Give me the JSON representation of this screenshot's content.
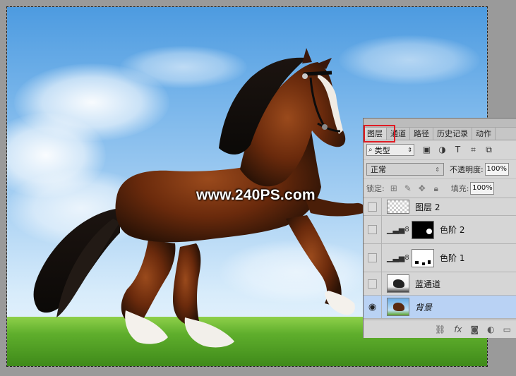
{
  "watermark": "www.240PS.com",
  "layers_panel": {
    "tabs": [
      {
        "label": "图层",
        "active": true
      },
      {
        "label": "通道",
        "active": false
      },
      {
        "label": "路径",
        "active": false
      },
      {
        "label": "历史记录",
        "active": false
      },
      {
        "label": "动作",
        "active": false
      }
    ],
    "kind_filter": "类型",
    "blend_mode": "正常",
    "opacity_label": "不透明度:",
    "opacity_value": "100%",
    "lock_label": "锁定:",
    "fill_label": "填充:",
    "fill_value": "100%",
    "layers": [
      {
        "name": "图层 2",
        "visible": false,
        "selected": false
      },
      {
        "name": "色阶 2",
        "visible": false,
        "selected": false
      },
      {
        "name": "色阶 1",
        "visible": false,
        "selected": false
      },
      {
        "name": "蓝通道",
        "visible": false,
        "selected": false
      },
      {
        "name": "背景",
        "visible": true,
        "selected": true
      }
    ],
    "footer_icons": [
      "link-icon",
      "fx-icon",
      "add-mask-icon",
      "adjustment-icon",
      "folder-icon"
    ]
  },
  "colors": {
    "selection_highlight": "#e01b24",
    "active_layer_bg": "#b9d2f4"
  }
}
